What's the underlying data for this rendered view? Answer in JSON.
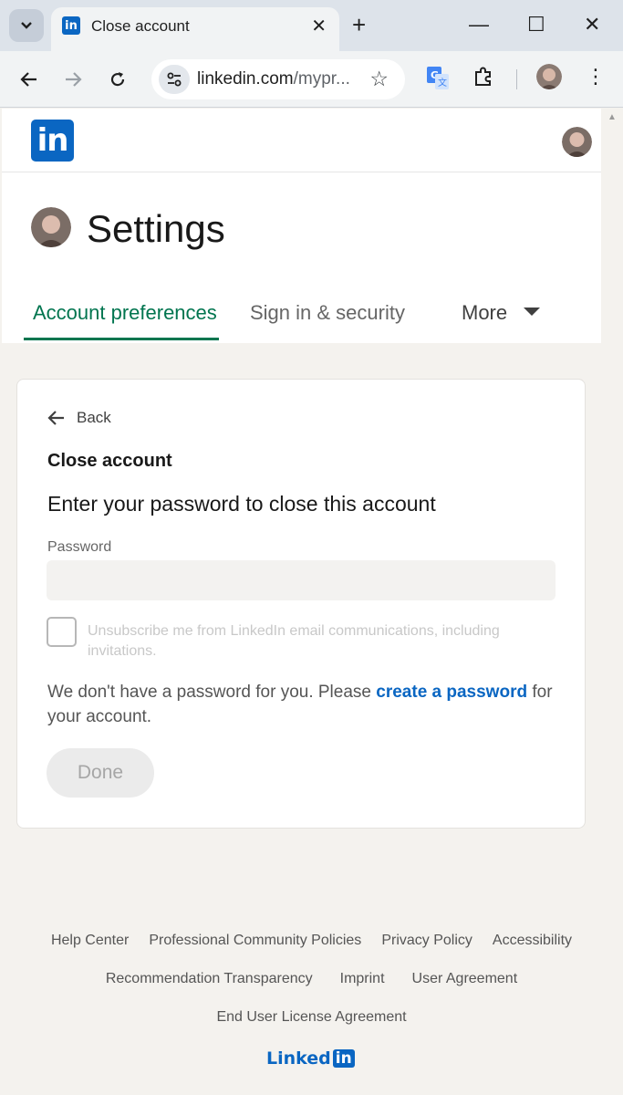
{
  "browser": {
    "tab_title": "Close account",
    "url_main": "linkedin.com",
    "url_rest": "/mypr...",
    "win_min": "—",
    "win_max": "☐",
    "win_close": "✕"
  },
  "header": {
    "logo_text": "in"
  },
  "settings": {
    "title": "Settings",
    "tabs": [
      {
        "label": "Account preferences",
        "active": true
      },
      {
        "label": "Sign in & security",
        "active": false
      },
      {
        "label": "More",
        "active": false
      }
    ]
  },
  "card": {
    "back_label": "Back",
    "title": "Close account",
    "subtitle": "Enter your password to close this account",
    "password_label": "Password",
    "password_value": "",
    "checkbox_label": "Unsubscribe me from LinkedIn email communications, including invitations.",
    "info_prefix": "We don't have a password for you. Please ",
    "info_link": "create a password",
    "info_suffix": " for your account.",
    "done_label": "Done"
  },
  "footer": {
    "row1": [
      "Help Center",
      "Professional Community Policies",
      "Privacy Policy",
      "Accessibility"
    ],
    "row2": [
      "Recommendation Transparency",
      "Imprint",
      "User Agreement"
    ],
    "row3": [
      "End User License Agreement"
    ],
    "logo_word": "Linked",
    "logo_in": "in"
  },
  "colors": {
    "brand_blue": "#0a66c2",
    "active_tab_green": "#01754f",
    "page_background": "#f4f2ee"
  }
}
